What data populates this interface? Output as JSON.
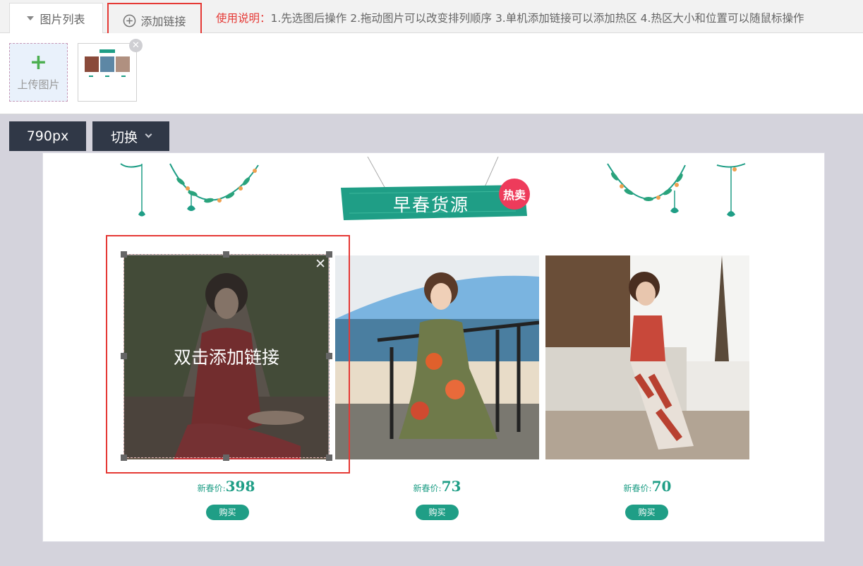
{
  "tabs": {
    "image_list": "图片列表",
    "add_link": "添加链接"
  },
  "instructions": {
    "label": "使用说明：",
    "text": "1.先选图后操作 2.拖动图片可以改变排列顺序 3.单机添加链接可以添加热区 4.热区大小和位置可以随鼠标操作"
  },
  "upload": {
    "plus": "+",
    "label": "上传图片"
  },
  "thumbnail": {
    "close": "✕"
  },
  "toolbar": {
    "width_label": "790px",
    "switch_label": "切换"
  },
  "banner": {
    "title": "早春货源",
    "hot_badge": "热卖"
  },
  "products": [
    {
      "price_label": "新春价:",
      "price": "398",
      "buy_label": "购买"
    },
    {
      "price_label": "新春价:",
      "price": "73",
      "buy_label": "购买"
    },
    {
      "price_label": "新春价:",
      "price": "70",
      "buy_label": "购买"
    }
  ],
  "hotspot": {
    "text": "双击添加链接",
    "close": "✕"
  },
  "colors": {
    "accent_red": "#e53935",
    "brand_teal": "#1f9e86",
    "toolbar_dark": "#303847",
    "hot_pink": "#ee3b5b"
  },
  "icons": {
    "tab_arrow": "caret-down-icon",
    "add_link": "plus-circle-icon",
    "switch_arrow": "chevron-down-icon",
    "close": "close-icon"
  }
}
